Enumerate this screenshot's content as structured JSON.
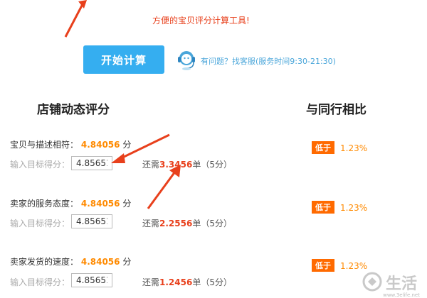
{
  "tagline": "方便的宝贝评分计算工具!",
  "start_button": "开始计算",
  "service": "有问题？找客服(服务时间9:30-21:30)",
  "left_title": "店铺动态评分",
  "right_title": "与同行相比",
  "metrics": [
    {
      "label": "宝贝与描述相符：",
      "score": "4.84056",
      "unit": "分",
      "input_label": "输入目标得分：",
      "target": "4.85651",
      "need_prefix": "还需",
      "need_value": "3.3456",
      "need_unit": "单（5分）",
      "badge": "低于",
      "pct": "1.23%"
    },
    {
      "label": "卖家的服务态度：",
      "score": "4.84056",
      "unit": "分",
      "input_label": "输入目标得分：",
      "target": "4.85651",
      "need_prefix": "还需",
      "need_value": "2.2556",
      "need_unit": "单（5分）",
      "badge": "低于",
      "pct": "1.23%"
    },
    {
      "label": "卖家发货的速度：",
      "score": "4.84056",
      "unit": "分",
      "input_label": "输入目标得分：",
      "target": "4.85651",
      "need_prefix": "还需",
      "need_value": "1.2456",
      "need_unit": "单（5分）",
      "badge": "低于",
      "pct": "1.23%"
    }
  ],
  "watermark": "生活",
  "watermark_url": "www.3elife.net",
  "colors": {
    "accent": "#35aef0",
    "orange": "#ff8a00",
    "red": "#e8401c",
    "badge": "#ff6a00"
  }
}
